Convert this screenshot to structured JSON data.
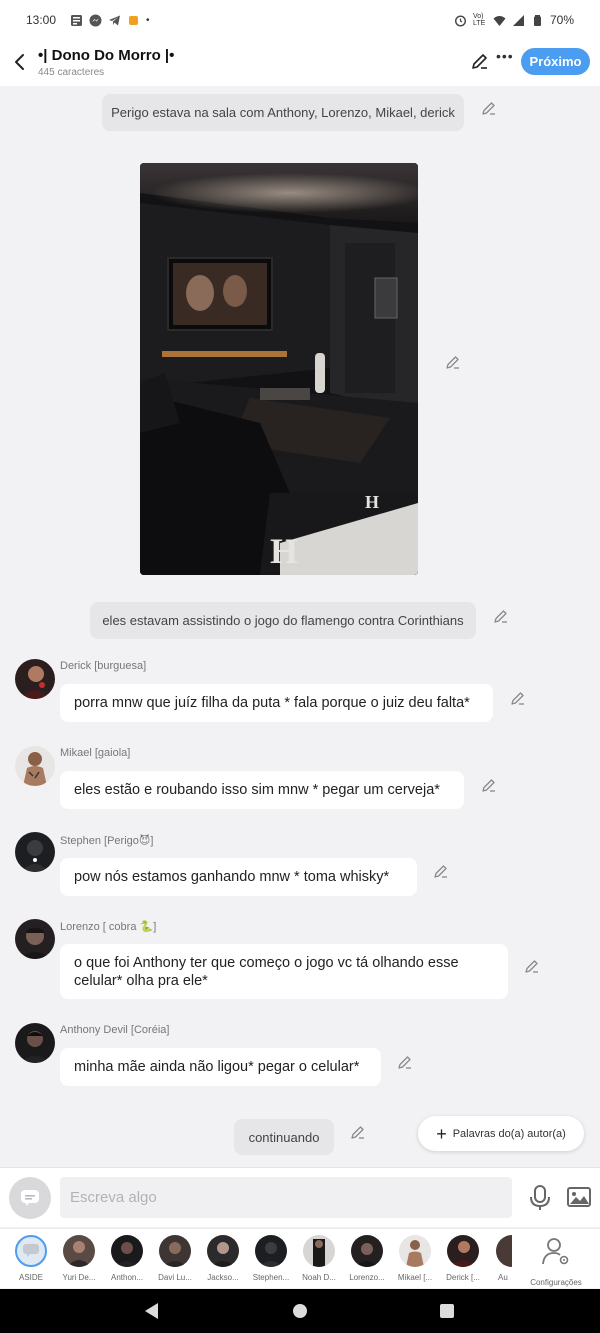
{
  "status_bar": {
    "time": "13:00",
    "network": "Vo) LTE",
    "battery": "70%"
  },
  "header": {
    "title": "•| Dono Do Morro |•",
    "subtitle": "445 caracteres",
    "next_label": "Próximo"
  },
  "narration": [
    "Perigo estava na sala com Anthony, Lorenzo, Mikael, derick",
    "eles estavam assistindo o jogo do flamengo contra Corinthians",
    "continuando"
  ],
  "messages": [
    {
      "name": "Derick [burguesa]",
      "text": "porra mnw que juíz filha da puta * fala porque o juiz deu falta*"
    },
    {
      "name": "Mikael [gaiola]",
      "text": "eles estão e roubando isso sim mnw * pegar um cerveja*"
    },
    {
      "name": "Stephen [Perigo😈]",
      "text": "pow nós estamos ganhando mnw * toma whisky*"
    },
    {
      "name": "Lorenzo [ cobra 🐍]",
      "text": "o que foi Anthony ter que começo o jogo vc tá olhando esse celular* olha pra ele*"
    },
    {
      "name": "Anthony Devil [Coréia]",
      "text": "minha mãe ainda não ligou* pegar o celular*"
    }
  ],
  "author_words_label": "Palavras do(a) autor(a)",
  "composer": {
    "placeholder": "Escreva algo"
  },
  "cast": [
    "ASIDE",
    "Yuri De...",
    "Anthon...",
    "Davi Lu...",
    "Jackso...",
    "Stephen...",
    "Noah D...",
    "Lorenzo...",
    "Mikael [...",
    "Derick [...",
    "Au",
    "Configurações"
  ],
  "colors": {
    "accent": "#4a9df0",
    "background": "#f2f2f4",
    "narration_bg": "#e6e6e8",
    "bubble_bg": "#ffffff"
  },
  "icons": [
    "back-arrow-icon",
    "pencil-icon",
    "more-icon",
    "mic-icon",
    "image-icon",
    "settings-person-icon",
    "chat-bubble-icon"
  ]
}
